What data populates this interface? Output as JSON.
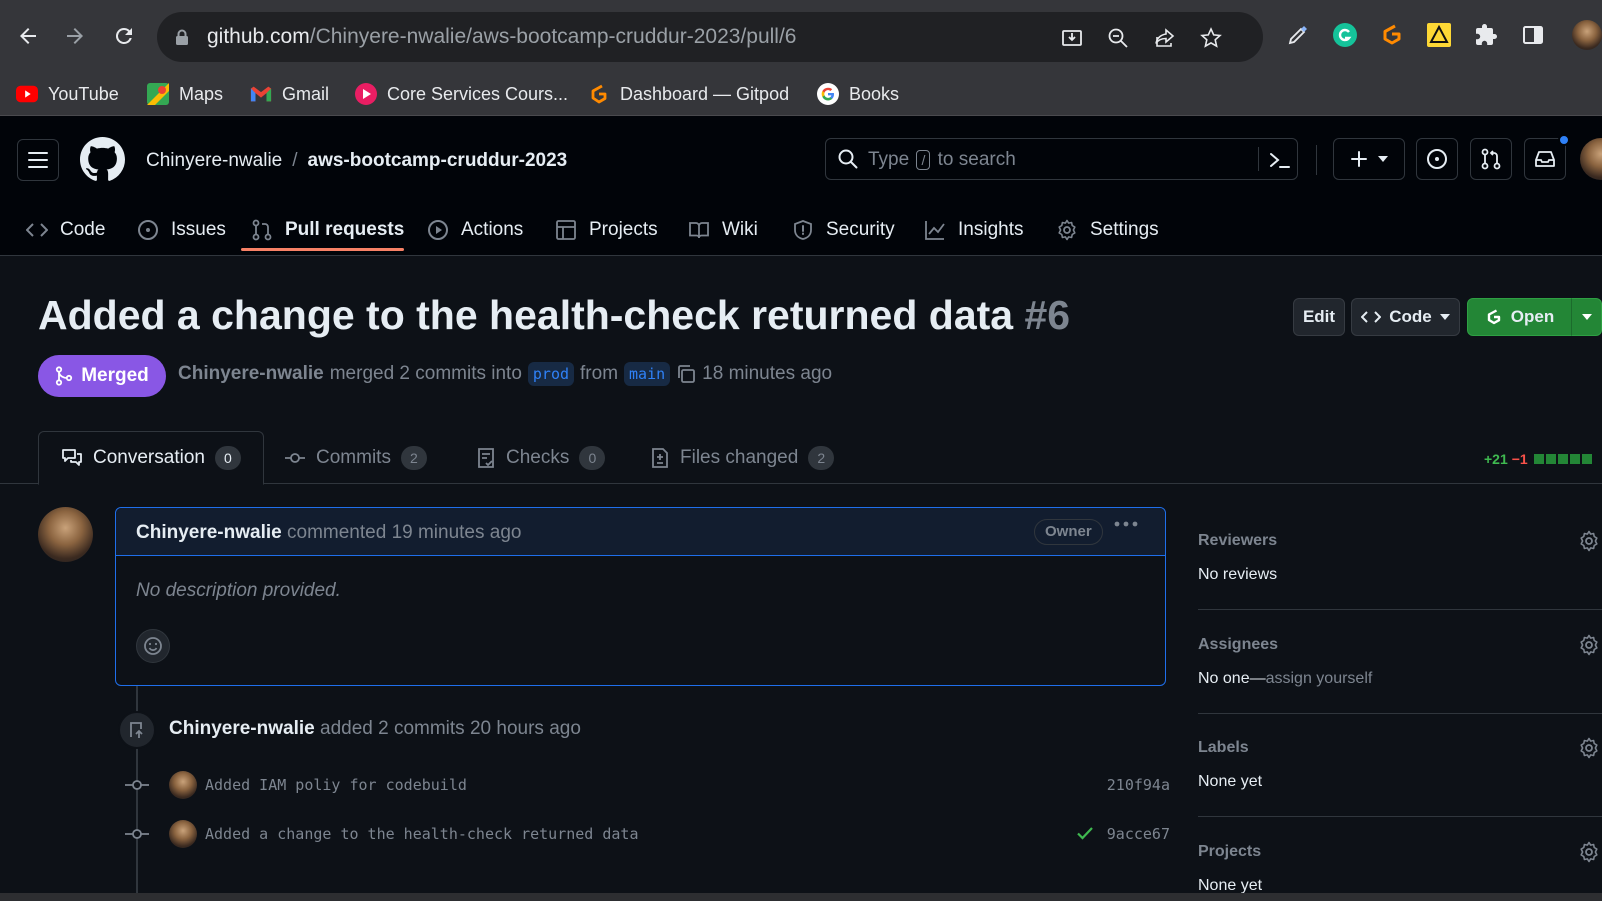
{
  "browser": {
    "url_host": "github.com",
    "url_path": "/Chinyere-nwalie/aws-bootcamp-cruddur-2023/pull/6",
    "bookmarks": [
      {
        "label": "YouTube",
        "icon": "youtube-icon",
        "color": "#ff0000"
      },
      {
        "label": "Maps",
        "icon": "maps-icon",
        "color": "#34a853"
      },
      {
        "label": "Gmail",
        "icon": "gmail-icon",
        "color": "#ea4335"
      },
      {
        "label": "Core Services Cours...",
        "icon": "core-services-icon",
        "color": "#e91e63"
      },
      {
        "label": "Dashboard — Gitpod",
        "icon": "gitpod-icon",
        "color": "#ff8a00"
      },
      {
        "label": "Books",
        "icon": "google-icon",
        "color": "#4285f4"
      }
    ]
  },
  "header": {
    "owner": "Chinyere-nwalie",
    "separator": "/",
    "repo": "aws-bootcamp-cruddur-2023",
    "search": {
      "prefix": "Type",
      "key": "/",
      "suffix": "to search"
    }
  },
  "repo_nav": [
    {
      "label": "Code",
      "icon": "code-icon"
    },
    {
      "label": "Issues",
      "icon": "issue-icon"
    },
    {
      "label": "Pull requests",
      "icon": "pull-request-icon",
      "active": true
    },
    {
      "label": "Actions",
      "icon": "actions-play-icon"
    },
    {
      "label": "Projects",
      "icon": "table-icon"
    },
    {
      "label": "Wiki",
      "icon": "book-icon"
    },
    {
      "label": "Security",
      "icon": "shield-icon"
    },
    {
      "label": "Insights",
      "icon": "graph-icon"
    },
    {
      "label": "Settings",
      "icon": "gear-icon"
    }
  ],
  "pr": {
    "title": "Added a change to the health-check returned data",
    "number": "#6",
    "state": "Merged",
    "author": "Chinyere-nwalie",
    "merged_text": "merged 2 commits into",
    "base": "prod",
    "from_text": "from",
    "head": "main",
    "time": "18 minutes ago",
    "buttons": {
      "edit": "Edit",
      "code": "Code",
      "open": "Open"
    },
    "state_color": "#8957e5"
  },
  "pr_tabs": [
    {
      "label": "Conversation",
      "count": "0",
      "active": true
    },
    {
      "label": "Commits",
      "count": "2"
    },
    {
      "label": "Checks",
      "count": "0"
    },
    {
      "label": "Files changed",
      "count": "2"
    }
  ],
  "diffstat": {
    "additions": "+21",
    "deletions": "−1",
    "blocks_green": 5,
    "blocks_gray": 0
  },
  "comment": {
    "author": "Chinyere-nwalie",
    "action": "commented",
    "time": "19 minutes ago",
    "badge": "Owner",
    "body": "No description provided."
  },
  "timeline": {
    "author": "Chinyere-nwalie",
    "action": "added 2 commits",
    "time": "20 hours ago",
    "commits": [
      {
        "message": "Added IAM poliy for codebuild",
        "sha": "210f94a",
        "checked": false
      },
      {
        "message": "Added a change to the health-check returned data",
        "sha": "9acce67",
        "checked": true
      }
    ]
  },
  "sidebar": [
    {
      "heading": "Reviewers",
      "value": "No reviews"
    },
    {
      "heading": "Assignees",
      "value": "No one—",
      "value_muted": "assign yourself"
    },
    {
      "heading": "Labels",
      "value": "None yet"
    },
    {
      "heading": "Projects",
      "value": "None yet"
    }
  ]
}
